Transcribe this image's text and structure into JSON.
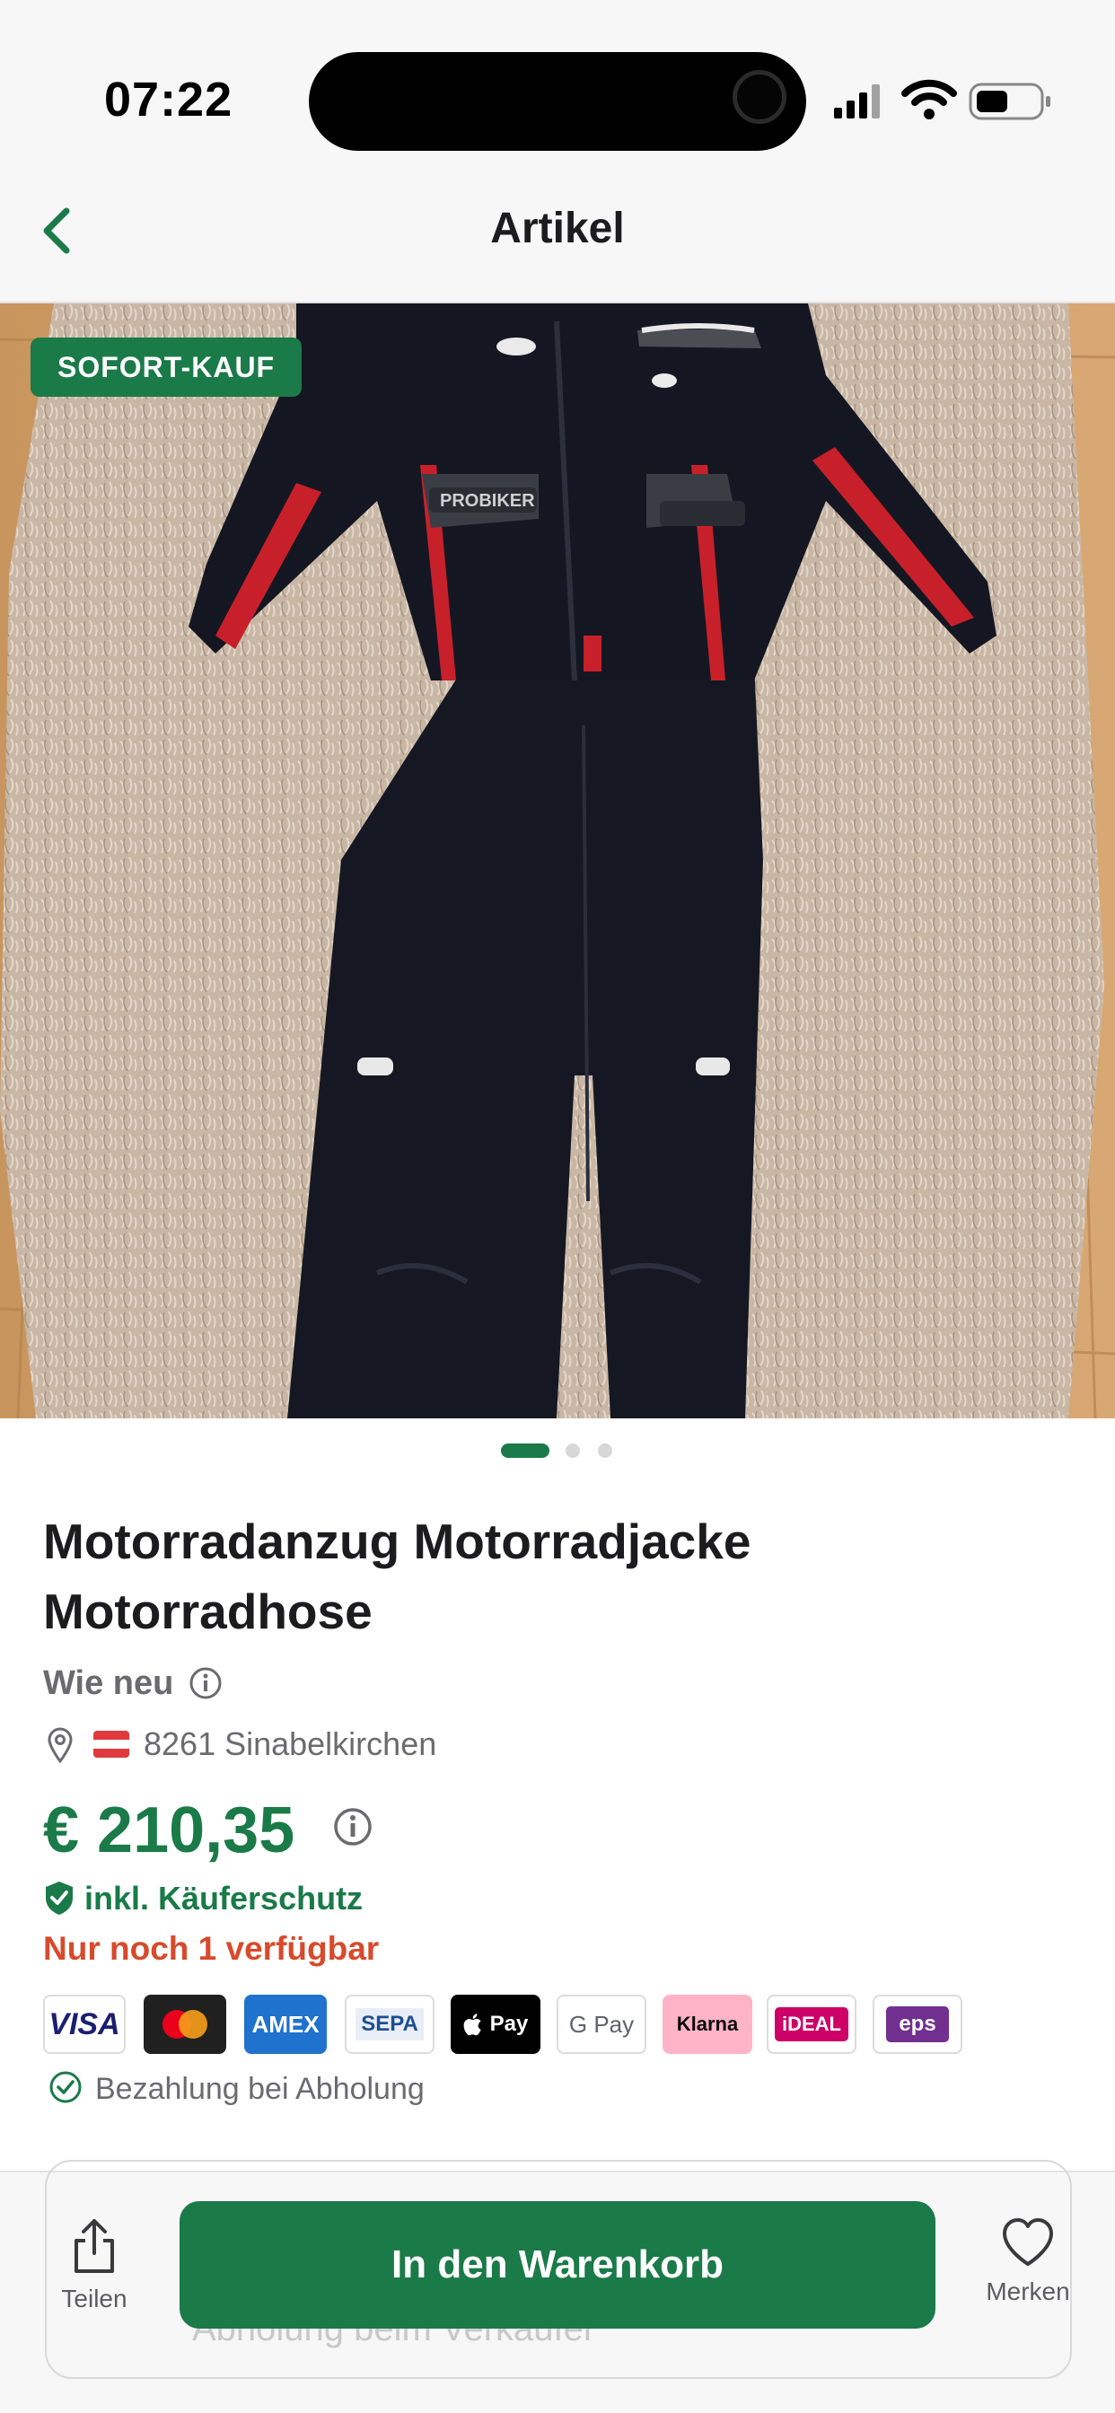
{
  "status_bar": {
    "time": "07:22"
  },
  "nav": {
    "title": "Artikel"
  },
  "listing": {
    "badge": "SOFORT-KAUF",
    "title": "Motorradanzug Motorradjacke Motorradhose",
    "condition": "Wie neu",
    "location": "8261 Sinabelkirchen",
    "country_flag": "austria-flag",
    "price": "€ 210,35",
    "buyer_protection": "inkl. Käuferschutz",
    "stock": "Nur noch 1 verfügbar",
    "image_count": 3,
    "active_image": 1,
    "jacket_brand_text": "PROBIKER"
  },
  "payment_methods": [
    "VISA",
    "Mastercard",
    "AMEX",
    "SEPA",
    "Pay",
    "G Pay",
    "Klarna",
    "iDEAL",
    "eps"
  ],
  "pickup_payment": "Bezahlung bei Abholung",
  "bottom_bar": {
    "share_label": "Teilen",
    "cart_label": "In den Warenkorb",
    "favorite_label": "Merken",
    "ghost_text": "Abholung beim Verkäufer"
  },
  "colors": {
    "primary_green": "#1a7a48",
    "warning_red": "#d84a2b",
    "muted_text": "#6b6b6f"
  }
}
